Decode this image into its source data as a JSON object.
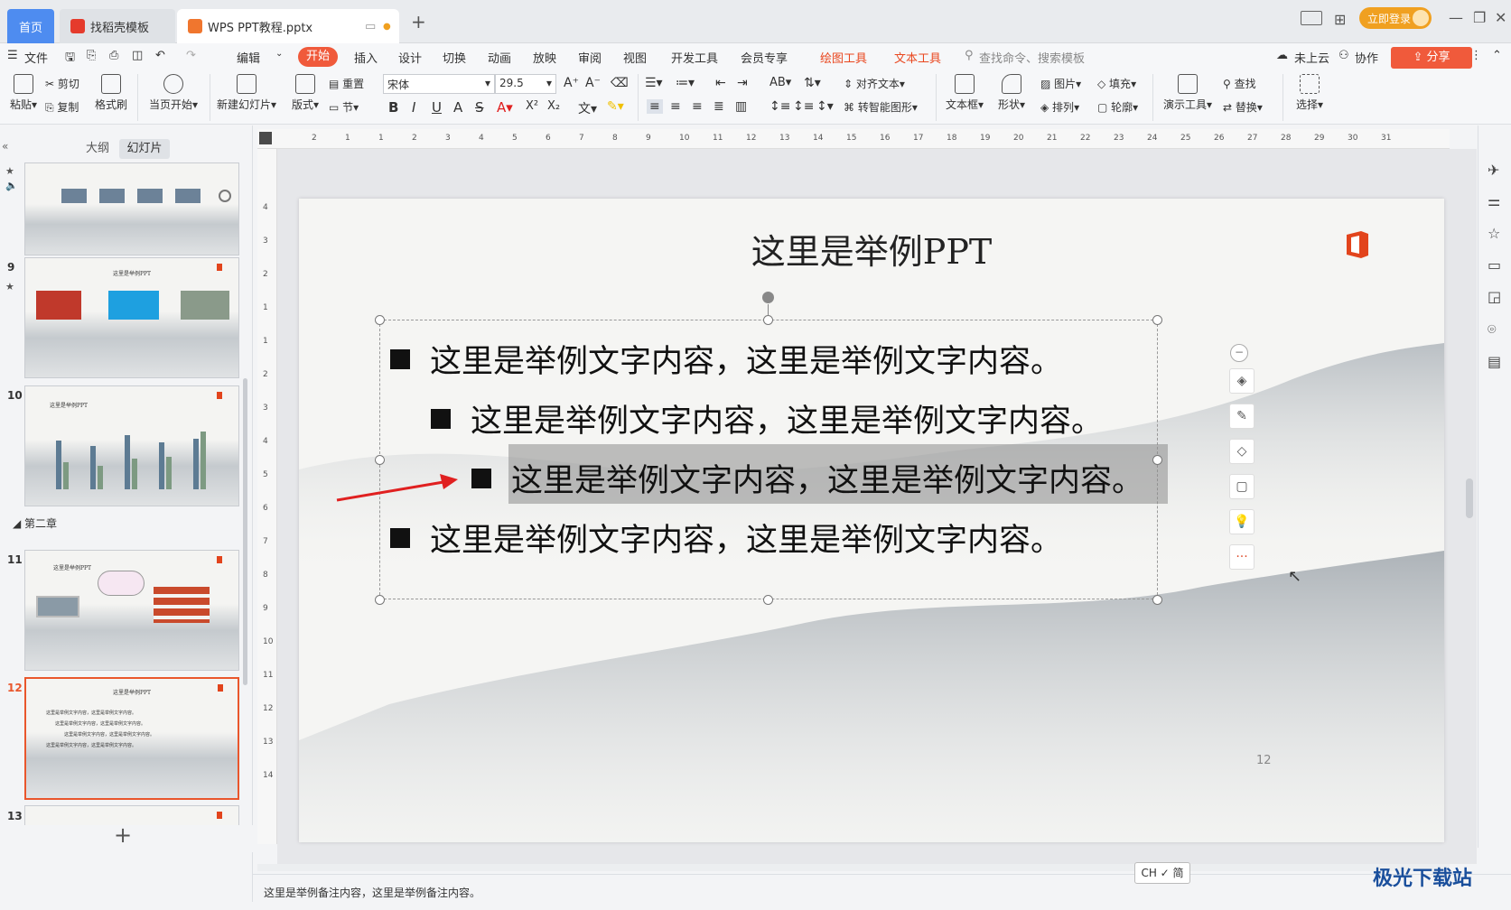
{
  "tabs": {
    "home": "首页",
    "template": "找稻壳模板",
    "file": "WPS PPT教程.pptx"
  },
  "titlebar": {
    "login": "立即登录",
    "minimize_icon": "—",
    "restore_icon": "❐",
    "close_icon": "✕"
  },
  "menu": {
    "file": "文件",
    "edit": "编辑",
    "start": "开始",
    "insert": "插入",
    "design": "设计",
    "switch": "切换",
    "animation": "动画",
    "show": "放映",
    "review": "审阅",
    "view": "视图",
    "dev": "开发工具",
    "member": "会员专享",
    "drawing_tools": "绘图工具",
    "text_tools": "文本工具",
    "search_placeholder": "查找命令、搜索模板",
    "cloud": "未上云",
    "collab": "协作",
    "share": "分享"
  },
  "ribbon": {
    "paste": "粘贴",
    "cut": "剪切",
    "copy": "复制",
    "format_painter": "格式刷",
    "from_current": "当页开始",
    "new_slide": "新建幻灯片",
    "layout": "版式",
    "reset": "重置",
    "section": "节",
    "font_name": "宋体",
    "font_size": "29.5",
    "bold": "B",
    "italic": "I",
    "underline": "U",
    "strike": "S",
    "superscript": "X²",
    "subscript": "X₂",
    "align_text": "对齐文本",
    "smart_shape": "转智能图形",
    "textbox": "文本框",
    "shape": "形状",
    "arrange": "排列",
    "picture": "图片",
    "fill": "填充",
    "outline": "轮廓",
    "presentation_tools": "演示工具",
    "find": "查找",
    "replace": "替换",
    "select": "选择"
  },
  "leftpanel": {
    "outline": "大纲",
    "slides": "幻灯片",
    "chapter2": "第二章",
    "add": "+",
    "slide_numbers": [
      "9",
      "10",
      "11",
      "12",
      "13"
    ],
    "thumb_title": "这里是举例PPT"
  },
  "ruler": {
    "h": [
      "2",
      "1",
      "1",
      "2",
      "3",
      "4",
      "5",
      "6",
      "7",
      "8",
      "9",
      "10",
      "11",
      "12",
      "13",
      "14",
      "15",
      "16",
      "17",
      "18",
      "19",
      "20",
      "21",
      "22",
      "23",
      "24",
      "25",
      "26",
      "27",
      "28",
      "29",
      "30",
      "31"
    ],
    "v": [
      "4",
      "3",
      "2",
      "1",
      "1",
      "2",
      "3",
      "4",
      "5",
      "6",
      "7",
      "8",
      "9",
      "10",
      "11",
      "12",
      "13",
      "14"
    ]
  },
  "slide": {
    "title": "这里是举例PPT",
    "bullets": [
      "这里是举例文字内容，这里是举例文字内容。",
      "这里是举例文字内容，这里是举例文字内容。",
      "这里是举例文字内容，这里是举例文字内容。",
      "这里是举例文字内容，这里是举例文字内容。"
    ],
    "page_number": "12"
  },
  "notes": {
    "text": "这里是举例备注内容，这里是举例备注内容。"
  },
  "ime": "CH ✓ 简",
  "watermark": "极光下载站",
  "colors": {
    "accent": "#f05a3b",
    "home_tab": "#4e8cf0",
    "arrow": "#e02020"
  }
}
